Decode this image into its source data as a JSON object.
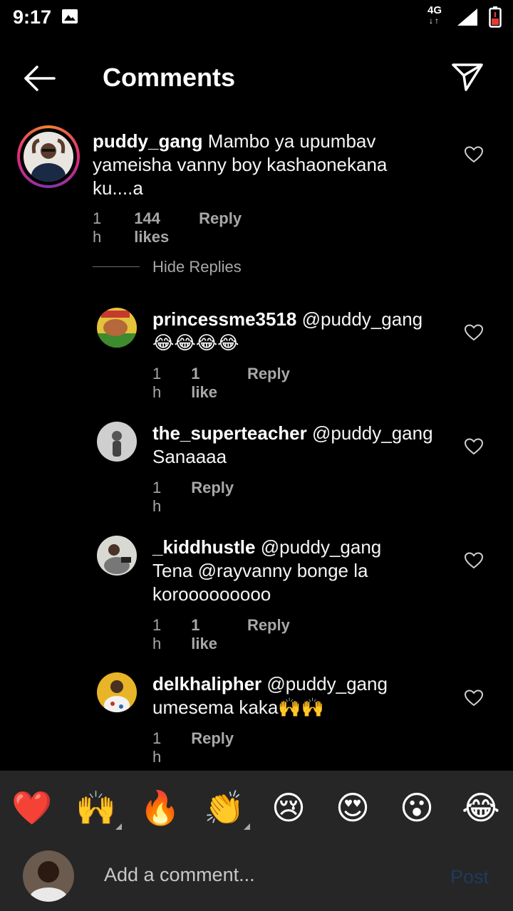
{
  "status_bar": {
    "time": "9:17",
    "network": "4G"
  },
  "header": {
    "title": "Comments"
  },
  "main_comment": {
    "username": "puddy_gang",
    "text": "Mambo ya upumbav yameisha vanny boy kashaonekana ku....a",
    "time": "1 h",
    "likes": "144 likes",
    "reply_label": "Reply"
  },
  "hide_replies_label": "Hide Replies",
  "replies": [
    {
      "username": "princessme3518",
      "mention": "@puddy_gang",
      "text": "😂😂😂😂",
      "time": "1 h",
      "likes": "1 like",
      "reply_label": "Reply"
    },
    {
      "username": "the_superteacher",
      "mention": "@puddy_gang",
      "text": "Sanaaaa",
      "time": "1 h",
      "likes": "",
      "reply_label": "Reply"
    },
    {
      "username": "_kiddhustle",
      "mention": "@puddy_gang",
      "text": "Tena @rayvanny bonge la korooooooooo",
      "time": "1 h",
      "likes": "1 like",
      "reply_label": "Reply"
    },
    {
      "username": "delkhalipher",
      "mention": "@puddy_gang",
      "text": "umesema kaka🙌🙌",
      "time": "1 h",
      "likes": "",
      "reply_label": "Reply"
    }
  ],
  "emoji_bar": [
    "❤️",
    "🙌",
    "🔥",
    "👏",
    "😢",
    "😍",
    "😮",
    "😂"
  ],
  "composer": {
    "placeholder": "Add a comment...",
    "post_label": "Post"
  },
  "colors": {
    "background": "#000000",
    "composer_bg": "#262626",
    "muted_text": "#a8a8a8",
    "post_disabled": "#1e3a5f"
  }
}
